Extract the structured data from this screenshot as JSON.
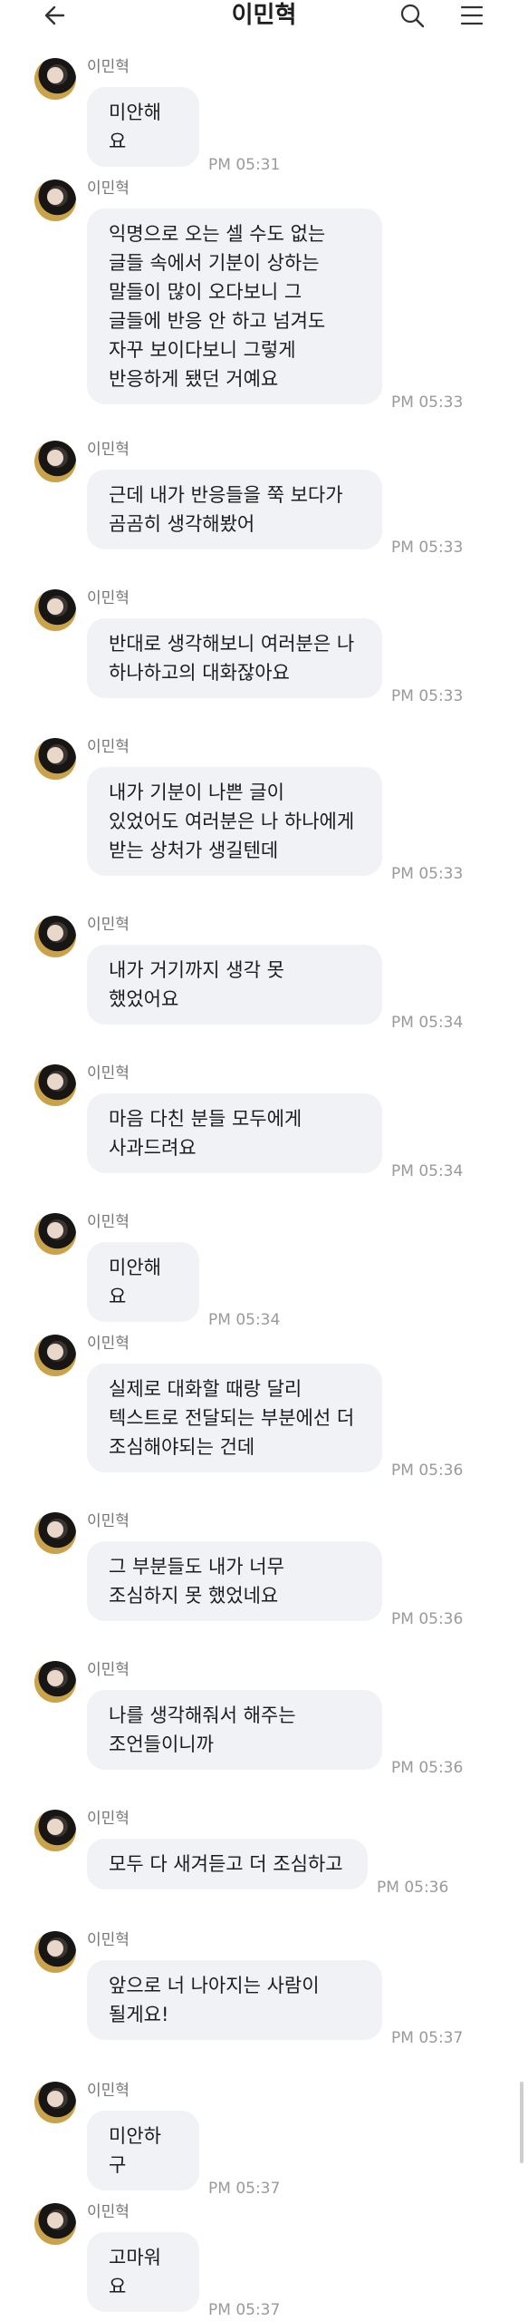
{
  "header": {
    "title": "이민혁"
  },
  "messages": [
    {
      "sender": "이민혁",
      "text": "미안해요",
      "time": "PM 05:31"
    },
    {
      "sender": "이민혁",
      "text": "익명으로 오는 셀 수도 없는\n글들 속에서 기분이 상하는\n말들이 많이 오다보니 그\n글들에 반응 안 하고 넘겨도\n자꾸 보이다보니 그렇게\n반응하게 됐던 거예요",
      "time": "PM 05:33"
    },
    {
      "sender": "이민혁",
      "text": "근데 내가 반응들을 쭉 보다가\n곰곰히 생각해봤어",
      "time": "PM 05:33"
    },
    {
      "sender": "이민혁",
      "text": "반대로 생각해보니 여러분은 나\n하나하고의 대화잖아요",
      "time": "PM 05:33"
    },
    {
      "sender": "이민혁",
      "text": "내가 기분이 나쁜 글이\n있었어도 여러분은 나 하나에게\n받는 상처가 생길텐데",
      "time": "PM 05:33"
    },
    {
      "sender": "이민혁",
      "text": "내가 거기까지 생각 못\n했었어요",
      "time": "PM 05:34"
    },
    {
      "sender": "이민혁",
      "text": "마음 다친 분들 모두에게\n사과드려요",
      "time": "PM 05:34"
    },
    {
      "sender": "이민혁",
      "text": "미안해요",
      "time": "PM 05:34"
    },
    {
      "sender": "이민혁",
      "text": "실제로 대화할 때랑 달리\n텍스트로 전달되는 부분에선 더\n조심해야되는 건데",
      "time": "PM 05:36"
    },
    {
      "sender": "이민혁",
      "text": "그 부분들도 내가 너무\n조심하지 못 했었네요",
      "time": "PM 05:36"
    },
    {
      "sender": "이민혁",
      "text": "나를 생각해줘서 해주는\n조언들이니까",
      "time": "PM 05:36"
    },
    {
      "sender": "이민혁",
      "text": "모두 다 새겨듣고 더 조심하고",
      "time": "PM 05:36"
    },
    {
      "sender": "이민혁",
      "text": "앞으로 너 나아지는 사람이\n될게요!",
      "time": "PM 05:37"
    },
    {
      "sender": "이민혁",
      "text": "미안하구",
      "time": "PM 05:37"
    },
    {
      "sender": "이민혁",
      "text": "고마워요",
      "time": "PM 05:37"
    }
  ]
}
